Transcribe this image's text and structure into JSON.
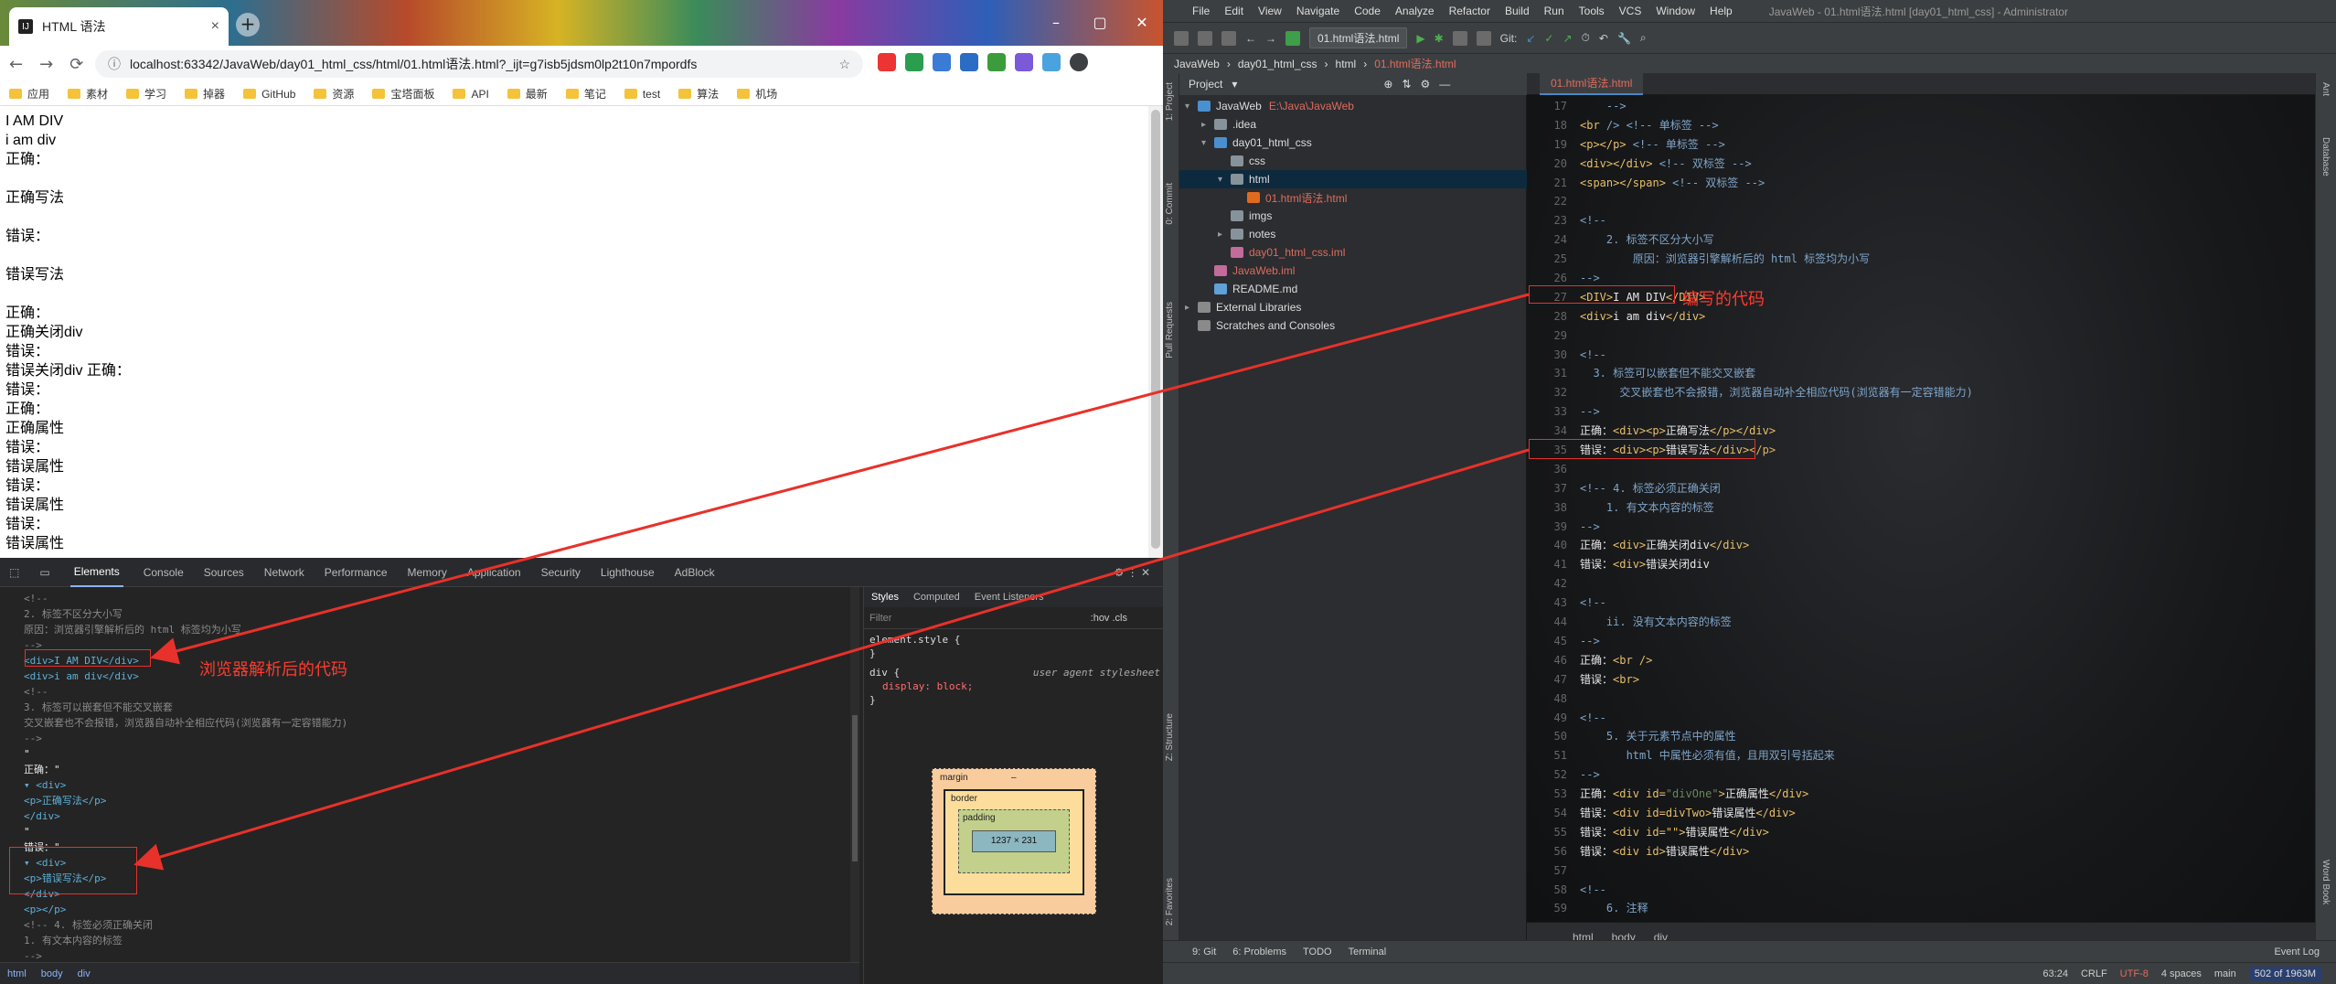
{
  "chrome": {
    "tab_title": "HTML 语法",
    "url": "localhost:63342/JavaWeb/day01_html_css/html/01.html语法.html?_ijt=g7isb5jdsm0lp2t10n7mpordfs",
    "bookmarks": [
      "应用",
      "素材",
      "学习",
      "掉器",
      "GitHub",
      "资源",
      "宝塔面板",
      "API",
      "最新",
      "笔记",
      "test",
      "算法",
      "机场"
    ],
    "content_lines": [
      "I AM DIV",
      "i am div",
      "正确：",
      "",
      "正确写法",
      "",
      "错误：",
      "",
      "错误写法",
      "",
      "正确：",
      "正确关闭div",
      "错误：",
      "错误关闭div 正确：",
      "错误：",
      "正确：",
      "正确属性",
      "错误：",
      "错误属性",
      "错误：",
      "错误属性",
      "错误：",
      "错误属性",
      "-->"
    ]
  },
  "devtools": {
    "tabs": [
      "Elements",
      "Console",
      "Sources",
      "Network",
      "Performance",
      "Memory",
      "Application",
      "Security",
      "Lighthouse",
      "AdBlock"
    ],
    "style_tabs": [
      "Styles",
      "Computed",
      "Event Listeners"
    ],
    "filter_placeholder": "Filter",
    "filter_hints": ":hov  .cls",
    "rule1": "element.style {",
    "rule1_end": "}",
    "rule2_selector": "div {",
    "rule2_source": "user agent stylesheet",
    "rule2_prop": "display: block;",
    "rule2_end": "}",
    "box": {
      "margin": "margin",
      "border": "border",
      "padding": "padding",
      "content": "1237 × 231",
      "dash": "–"
    },
    "crumbs": [
      "html",
      "body",
      "div"
    ],
    "dom_lines": [
      {
        "t": "cm",
        "v": "<!--"
      },
      {
        "t": "cm",
        "v": "    2. 标签不区分大小写"
      },
      {
        "t": "cm",
        "v": "        原因：浏览器引擎解析后的 html 标签均为小写"
      },
      {
        "t": "cm",
        "v": "-->"
      },
      {
        "t": "tag",
        "v": "<div>I AM DIV</div>"
      },
      {
        "t": "tag",
        "v": "<div>i am div</div>"
      },
      {
        "t": "cm",
        "v": "<!--"
      },
      {
        "t": "cm",
        "v": "    3. 标签可以嵌套但不能交叉嵌套"
      },
      {
        "t": "cm",
        "v": "        交叉嵌套也不会报错，浏览器自动补全相应代码(浏览器有一定容错能力)"
      },
      {
        "t": "cm",
        "v": "-->"
      },
      {
        "t": "txt",
        "v": "\""
      },
      {
        "t": "txt",
        "v": "正确：\""
      },
      {
        "t": "tag",
        "v": "▾ <div>"
      },
      {
        "t": "tag",
        "v": "    <p>正确写法</p>"
      },
      {
        "t": "tag",
        "v": "  </div>"
      },
      {
        "t": "txt",
        "v": "  \""
      },
      {
        "t": "txt",
        "v": "错误：\""
      },
      {
        "t": "tag",
        "v": "▾ <div>"
      },
      {
        "t": "tag",
        "v": "    <p>错误写法</p>"
      },
      {
        "t": "tag",
        "v": "  </div>"
      },
      {
        "t": "tag",
        "v": "  <p></p>"
      },
      {
        "t": "cm",
        "v": "  <!-- 4. 标签必须正确关闭"
      },
      {
        "t": "cm",
        "v": "      1. 有文本内容的标签"
      },
      {
        "t": "cm",
        "v": "  -->"
      }
    ]
  },
  "ide": {
    "menu": [
      "File",
      "Edit",
      "View",
      "Navigate",
      "Code",
      "Analyze",
      "Refactor",
      "Build",
      "Run",
      "Tools",
      "VCS",
      "Window",
      "Help"
    ],
    "title": "JavaWeb - 01.html语法.html [day01_html_css] - Administrator",
    "run_config": "01.html语法.html",
    "git_label": "Git:",
    "nav": [
      "JavaWeb",
      "day01_html_css",
      "html",
      "01.html语法.html"
    ],
    "project_label": "Project",
    "tree": [
      {
        "d": 0,
        "a": "▾",
        "n": "JavaWeb",
        "extra": "E:\\Java\\JavaWeb",
        "c": "#4a8fd0"
      },
      {
        "d": 1,
        "a": "▸",
        "n": ".idea",
        "c": "#87939a"
      },
      {
        "d": 1,
        "a": "▾",
        "n": "day01_html_css",
        "c": "#4a8fd0"
      },
      {
        "d": 2,
        "a": "",
        "n": "css",
        "c": "#87939a"
      },
      {
        "d": 2,
        "a": "▾",
        "n": "html",
        "c": "#87939a",
        "sel": true
      },
      {
        "d": 3,
        "a": "",
        "n": "01.html语法.html",
        "c": "#e06b1e",
        "red": true
      },
      {
        "d": 2,
        "a": "",
        "n": "imgs",
        "c": "#87939a"
      },
      {
        "d": 2,
        "a": "▸",
        "n": "notes",
        "c": "#87939a"
      },
      {
        "d": 2,
        "a": "",
        "n": "day01_html_css.iml",
        "c": "#c36b9a",
        "red": true
      },
      {
        "d": 1,
        "a": "",
        "n": "JavaWeb.iml",
        "c": "#c36b9a",
        "red": true
      },
      {
        "d": 1,
        "a": "",
        "n": "README.md",
        "c": "#5fa1d9"
      },
      {
        "d": 0,
        "a": "▸",
        "n": "External Libraries",
        "c": "#8a8a8a"
      },
      {
        "d": 0,
        "a": "",
        "n": "Scratches and Consoles",
        "c": "#8a8a8a"
      }
    ],
    "errors": "2",
    "warnings": "1",
    "oks": "1",
    "line_numbers": [
      "17",
      "18",
      "19",
      "20",
      "21",
      "22",
      "23",
      "24",
      "25",
      "26",
      "27",
      "28",
      "29",
      "30",
      "31",
      "32",
      "33",
      "34",
      "35",
      "36",
      "37",
      "38",
      "39",
      "40",
      "41",
      "42",
      "43",
      "44",
      "45",
      "46",
      "47",
      "48",
      "49",
      "50",
      "51",
      "52",
      "53",
      "54",
      "55",
      "56",
      "57",
      "58",
      "59"
    ],
    "code": [
      [
        [
          "c",
          "    -->"
        ]
      ],
      [
        [
          "k",
          "<br"
        ],
        [
          "c",
          " /> <!-- 单标签 -->"
        ]
      ],
      [
        [
          "k",
          "<p></p>"
        ],
        [
          "c",
          " <!-- 单标签 -->"
        ]
      ],
      [
        [
          "k",
          "<div></div>"
        ],
        [
          "c",
          " <!-- 双标签 -->"
        ]
      ],
      [
        [
          "k",
          "<span></span>"
        ],
        [
          "c",
          " <!-- 双标签 -->"
        ]
      ],
      [
        [
          "c",
          ""
        ]
      ],
      [
        [
          "c",
          "<!--"
        ]
      ],
      [
        [
          "c",
          "    2. 标签不区分大小写"
        ]
      ],
      [
        [
          "c",
          "        原因：浏览器引擎解析后的 html 标签均为小写"
        ]
      ],
      [
        [
          "c",
          "-->"
        ]
      ],
      [
        [
          "k",
          "<DIV>"
        ],
        [
          "w",
          "I AM DIV"
        ],
        [
          "k",
          "</DIV>"
        ]
      ],
      [
        [
          "k",
          "<div>"
        ],
        [
          "w",
          "i am div"
        ],
        [
          "k",
          "</div>"
        ]
      ],
      [
        [
          "c",
          ""
        ]
      ],
      [
        [
          "c",
          "<!--"
        ]
      ],
      [
        [
          "c",
          "  3. 标签可以嵌套但不能交叉嵌套"
        ]
      ],
      [
        [
          "c",
          "      交叉嵌套也不会报错，浏览器自动补全相应代码(浏览器有一定容错能力)"
        ]
      ],
      [
        [
          "c",
          "-->"
        ]
      ],
      [
        [
          "w",
          "正确："
        ],
        [
          "k",
          "<div><p>"
        ],
        [
          "w",
          "正确写法"
        ],
        [
          "k",
          "</p></div>"
        ]
      ],
      [
        [
          "w",
          "错误："
        ],
        [
          "k",
          "<div><p>"
        ],
        [
          "w",
          "错误写法"
        ],
        [
          "k",
          "</div>"
        ],
        [
          "y",
          "</p>"
        ]
      ],
      [
        [
          "c",
          ""
        ]
      ],
      [
        [
          "c",
          "<!-- 4. 标签必须正确关闭"
        ]
      ],
      [
        [
          "c",
          "    1. 有文本内容的标签"
        ]
      ],
      [
        [
          "c",
          "-->"
        ]
      ],
      [
        [
          "w",
          "正确："
        ],
        [
          "k",
          "<div>"
        ],
        [
          "w",
          "正确关闭div"
        ],
        [
          "k",
          "</div>"
        ]
      ],
      [
        [
          "w",
          "错误："
        ],
        [
          "k",
          "<div>"
        ],
        [
          "w",
          "错误关闭div"
        ]
      ],
      [
        [
          "c",
          ""
        ]
      ],
      [
        [
          "c",
          "<!--"
        ]
      ],
      [
        [
          "c",
          "    ii. 没有文本内容的标签"
        ]
      ],
      [
        [
          "c",
          "-->"
        ]
      ],
      [
        [
          "w",
          "正确："
        ],
        [
          "k",
          "<br />"
        ]
      ],
      [
        [
          "w",
          "错误："
        ],
        [
          "k",
          "<br>"
        ]
      ],
      [
        [
          "c",
          ""
        ]
      ],
      [
        [
          "c",
          "<!--"
        ]
      ],
      [
        [
          "c",
          "    5. 关于元素节点中的属性"
        ]
      ],
      [
        [
          "c",
          "       html 中属性必须有值，且用双引号括起来"
        ]
      ],
      [
        [
          "c",
          "-->"
        ]
      ],
      [
        [
          "w",
          "正确："
        ],
        [
          "k",
          "<div id="
        ],
        [
          "s",
          "\"divOne\""
        ],
        [
          "k",
          ">"
        ],
        [
          "w",
          "正确属性"
        ],
        [
          "k",
          "</div>"
        ]
      ],
      [
        [
          "w",
          "错误："
        ],
        [
          "k",
          "<div id=divTwo>"
        ],
        [
          "w",
          "错误属性"
        ],
        [
          "k",
          "</div>"
        ]
      ],
      [
        [
          "w",
          "错误："
        ],
        [
          "k",
          "<div id=\"\">"
        ],
        [
          "w",
          "错误属性"
        ],
        [
          "k",
          "</div>"
        ]
      ],
      [
        [
          "w",
          "错误："
        ],
        [
          "k",
          "<div id>"
        ],
        [
          "w",
          "错误属性"
        ],
        [
          "k",
          "</div>"
        ]
      ],
      [
        [
          "c",
          ""
        ]
      ],
      [
        [
          "c",
          "<!--"
        ]
      ],
      [
        [
          "c",
          "    6. 注释"
        ]
      ]
    ],
    "crumbs": [
      "html",
      "body",
      "div"
    ],
    "bottom_tools": [
      "9: Git",
      "6: Problems",
      "TODO",
      "Terminal"
    ],
    "event_log": "Event Log",
    "status": [
      "63:24",
      "CRLF",
      "UTF-8",
      "4 spaces",
      "main"
    ],
    "memory": "502 of 1963M",
    "left_tools": [
      "1: Project",
      "0: Commit",
      "Pull Requests",
      "Z: Structure",
      "2: Favorites"
    ],
    "right_tools": [
      "Ant",
      "Database",
      "Word Book"
    ]
  },
  "annotations": {
    "browser_parsed": "浏览器解析后的代码",
    "written_code": "编写的代码"
  }
}
